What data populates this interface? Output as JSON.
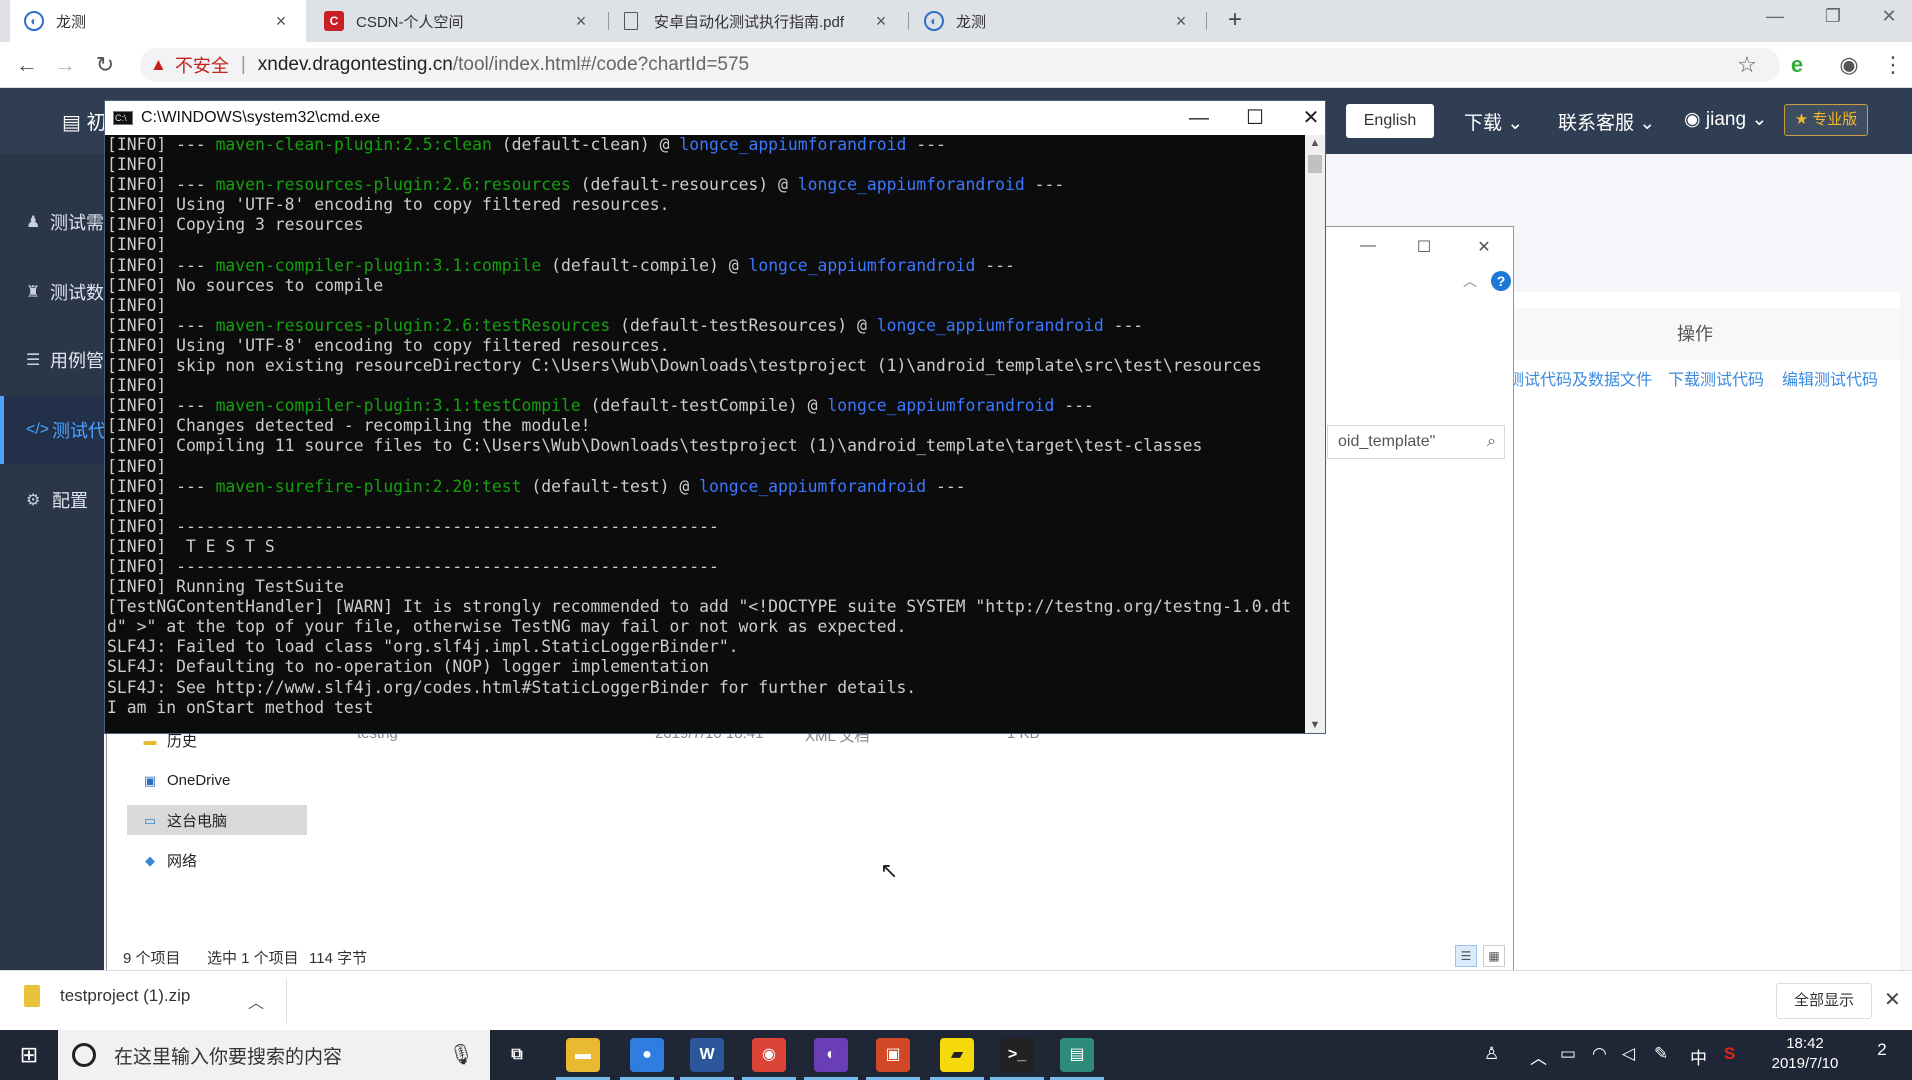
{
  "browser": {
    "tabs": [
      {
        "title": "龙测",
        "favicon": "globe-icon",
        "active": true
      },
      {
        "title": "CSDN-个人空间",
        "favicon": "C",
        "active": false
      },
      {
        "title": "安卓自动化测试执行指南.pdf",
        "favicon": "document-icon",
        "active": false
      },
      {
        "title": "龙测",
        "favicon": "globe-icon",
        "active": false
      }
    ],
    "close_glyph": "×",
    "new_tab": "+",
    "address": {
      "insecure_label": "不安全",
      "url_host": "xndev.dragontesting.cn",
      "url_path": "/tool/index.html#/code?chartId=575"
    }
  },
  "site": {
    "language_button": "English",
    "nav_download": "下载",
    "nav_support": "联系客服",
    "user_name": "jiang",
    "pro_badge": "★ 专业版",
    "sidebar": {
      "items": [
        {
          "label": "测试需",
          "icon": "user-icon"
        },
        {
          "label": "测试数",
          "icon": "person-icon"
        },
        {
          "label": "用例管",
          "icon": "list-icon"
        },
        {
          "label": "测试代",
          "icon": "code-icon"
        },
        {
          "label": "配置",
          "icon": "gear-icon"
        }
      ],
      "top_label": "初"
    },
    "ops_header": "操作",
    "op_links": [
      "测试代码及数据文件",
      "下载测试代码",
      "编辑测试代码"
    ]
  },
  "explorer": {
    "search_text": "oid_template\"",
    "nav_items": [
      {
        "label": "历史",
        "icon": "folder-icon"
      },
      {
        "label": "OneDrive",
        "icon": "cloud-icon"
      },
      {
        "label": "这台电脑",
        "icon": "computer-icon"
      },
      {
        "label": "网络",
        "icon": "network-icon"
      }
    ],
    "file_row": {
      "name": "testng",
      "date": "2019/7/10 18:41",
      "type": "XML 文档",
      "size": "1 KB"
    },
    "status": {
      "count": "9 个项目",
      "selected": "选中 1 个项目",
      "bytes": "114 字节"
    }
  },
  "cmd": {
    "title": "C:\\WINDOWS\\system32\\cmd.exe",
    "lines": [
      [
        {
          "t": "[INFO] --- "
        },
        {
          "t": "maven-clean-plugin:2.5:clean",
          "c": "g"
        },
        {
          "t": " (default-clean) @ "
        },
        {
          "t": "longce_appiumforandroid",
          "c": "b"
        },
        {
          "t": " ---"
        }
      ],
      [
        {
          "t": "[INFO]"
        }
      ],
      [
        {
          "t": "[INFO] --- "
        },
        {
          "t": "maven-resources-plugin:2.6:resources",
          "c": "g"
        },
        {
          "t": " (default-resources) @ "
        },
        {
          "t": "longce_appiumforandroid",
          "c": "b"
        },
        {
          "t": " ---"
        }
      ],
      [
        {
          "t": "[INFO] Using 'UTF-8' encoding to copy filtered resources."
        }
      ],
      [
        {
          "t": "[INFO] Copying 3 resources"
        }
      ],
      [
        {
          "t": "[INFO]"
        }
      ],
      [
        {
          "t": "[INFO] --- "
        },
        {
          "t": "maven-compiler-plugin:3.1:compile",
          "c": "g"
        },
        {
          "t": " (default-compile) @ "
        },
        {
          "t": "longce_appiumforandroid",
          "c": "b"
        },
        {
          "t": " ---"
        }
      ],
      [
        {
          "t": "[INFO] No sources to compile"
        }
      ],
      [
        {
          "t": "[INFO]"
        }
      ],
      [
        {
          "t": "[INFO] --- "
        },
        {
          "t": "maven-resources-plugin:2.6:testResources",
          "c": "g"
        },
        {
          "t": " (default-testResources) @ "
        },
        {
          "t": "longce_appiumforandroid",
          "c": "b"
        },
        {
          "t": " ---"
        }
      ],
      [
        {
          "t": "[INFO] Using 'UTF-8' encoding to copy filtered resources."
        }
      ],
      [
        {
          "t": "[INFO] skip non existing resourceDirectory C:\\Users\\Wub\\Downloads\\testproject (1)\\android_template\\src\\test\\resources"
        }
      ],
      [
        {
          "t": "[INFO]"
        }
      ],
      [
        {
          "t": "[INFO] --- "
        },
        {
          "t": "maven-compiler-plugin:3.1:testCompile",
          "c": "g"
        },
        {
          "t": " (default-testCompile) @ "
        },
        {
          "t": "longce_appiumforandroid",
          "c": "b"
        },
        {
          "t": " ---"
        }
      ],
      [
        {
          "t": "[INFO] Changes detected - recompiling the module!"
        }
      ],
      [
        {
          "t": "[INFO] Compiling 11 source files to C:\\Users\\Wub\\Downloads\\testproject (1)\\android_template\\target\\test-classes"
        }
      ],
      [
        {
          "t": "[INFO]"
        }
      ],
      [
        {
          "t": "[INFO] --- "
        },
        {
          "t": "maven-surefire-plugin:2.20:test",
          "c": "g"
        },
        {
          "t": " (default-test) @ "
        },
        {
          "t": "longce_appiumforandroid",
          "c": "b"
        },
        {
          "t": " ---"
        }
      ],
      [
        {
          "t": "[INFO]"
        }
      ],
      [
        {
          "t": "[INFO] -------------------------------------------------------"
        }
      ],
      [
        {
          "t": "[INFO]  T E S T S"
        }
      ],
      [
        {
          "t": "[INFO] -------------------------------------------------------"
        }
      ],
      [
        {
          "t": "[INFO] Running TestSuite"
        }
      ],
      [
        {
          "t": "[TestNGContentHandler] [WARN] It is strongly recommended to add \"<!DOCTYPE suite SYSTEM \"http://testng.org/testng-1.0.dt"
        }
      ],
      [
        {
          "t": "d\" >\" at the top of your file, otherwise TestNG may fail or not work as expected."
        }
      ],
      [
        {
          "t": "SLF4J: Failed to load class \"org.slf4j.impl.StaticLoggerBinder\"."
        }
      ],
      [
        {
          "t": "SLF4J: Defaulting to no-operation (NOP) logger implementation"
        }
      ],
      [
        {
          "t": "SLF4J: See http://www.slf4j.org/codes.html#StaticLoggerBinder for further details."
        }
      ],
      [
        {
          "t": "I am in onStart method test"
        }
      ]
    ]
  },
  "download": {
    "file": "testproject (1).zip",
    "show_all": "全部显示"
  },
  "taskbar": {
    "search_placeholder": "在这里输入你要搜索的内容",
    "apps": [
      {
        "name": "task-view-icon",
        "glyph": "⧉",
        "color": "#1f2736"
      },
      {
        "name": "file-explorer-icon",
        "glyph": "▬",
        "color": "#e8b931"
      },
      {
        "name": "browser-icon",
        "glyph": "●",
        "color": "#2f7de1"
      },
      {
        "name": "word-icon",
        "glyph": "W",
        "color": "#2b579a"
      },
      {
        "name": "chrome-icon",
        "glyph": "◉",
        "color": "#db4437"
      },
      {
        "name": "media-app-icon",
        "glyph": "◐",
        "color": "#6a3fb5"
      },
      {
        "name": "presentation-app-icon",
        "glyph": "▣",
        "color": "#d24726"
      },
      {
        "name": "sticky-notes-icon",
        "glyph": "▰",
        "color": "#f5d90a"
      },
      {
        "name": "cmd-icon",
        "glyph": ">_",
        "color": "#222222"
      },
      {
        "name": "window-app-icon",
        "glyph": "▤",
        "color": "#2e8b7a"
      }
    ],
    "ime": "中",
    "time": "18:42",
    "date": "2019/7/10",
    "notification_count": "2"
  },
  "colors": {
    "console_green": "#13a10e",
    "console_blue": "#3b78ff",
    "link_blue": "#3c8be0",
    "nav_dark": "#2f3e52"
  }
}
